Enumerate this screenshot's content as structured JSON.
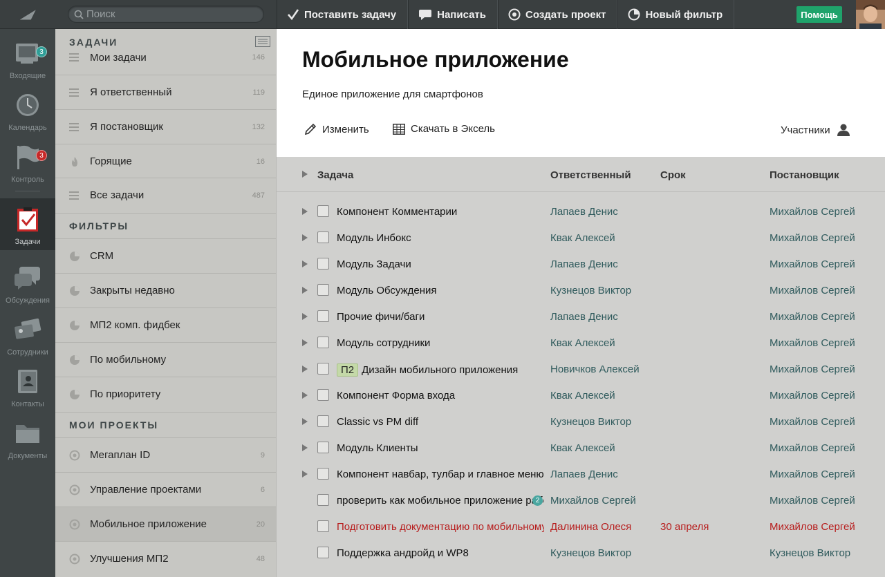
{
  "topbar": {
    "search_placeholder": "Поиск",
    "actions": [
      {
        "label": "Поставить задачу",
        "icon": "check-icon"
      },
      {
        "label": "Написать",
        "icon": "speech-bubble-icon"
      },
      {
        "label": "Создать проект",
        "icon": "target-icon"
      },
      {
        "label": "Новый фильтр",
        "icon": "pie-icon"
      }
    ],
    "help_label": "Помощь"
  },
  "leftnav": [
    {
      "label": "Входящие",
      "icon": "inbox-icon",
      "badge": "3"
    },
    {
      "label": "Календарь",
      "icon": "clock-icon"
    },
    {
      "label": "Контроль",
      "icon": "flag-icon",
      "badge": "3"
    },
    {
      "label": "Задачи",
      "icon": "clipboard-check-icon",
      "active": true
    },
    {
      "label": "Обсуждения",
      "icon": "chat-icon"
    },
    {
      "label": "Сотрудники",
      "icon": "id-cards-icon"
    },
    {
      "label": "Контакты",
      "icon": "address-book-icon"
    },
    {
      "label": "Документы",
      "icon": "folder-icon"
    }
  ],
  "sidebar": {
    "tasks_heading": "ЗАДАЧИ",
    "tasks": [
      {
        "label": "Мои задачи",
        "count": "146"
      },
      {
        "label": "Я ответственный",
        "count": "119"
      },
      {
        "label": "Я постановщик",
        "count": "132"
      },
      {
        "label": "Горящие",
        "count": "16"
      },
      {
        "label": "Все задачи",
        "count": "487"
      }
    ],
    "filters_heading": "ФИЛЬТРЫ",
    "filters": [
      {
        "label": "CRM"
      },
      {
        "label": "Закрыты недавно"
      },
      {
        "label": "МП2 комп. фидбек"
      },
      {
        "label": "По мобильному"
      },
      {
        "label": "По приоритету"
      }
    ],
    "projects_heading": "МОИ ПРОЕКТЫ",
    "projects": [
      {
        "label": "Мегаплан ID",
        "count": "9"
      },
      {
        "label": "Управление проектами",
        "count": "6"
      },
      {
        "label": "Мобильное приложение",
        "count": "20"
      },
      {
        "label": "Улучшения МП2",
        "count": "48"
      }
    ]
  },
  "project": {
    "title": "Мобильное приложение",
    "subtitle": "Единое приложение для смартфонов",
    "edit_label": "Изменить",
    "excel_label": "Скачать в Эксель",
    "members_label": "Участники"
  },
  "table": {
    "headers": {
      "task": "Задача",
      "responsible": "Ответственный",
      "due": "Срок",
      "author": "Постановщик"
    },
    "rows": [
      {
        "tag": "",
        "name": "Компонент Комментарии",
        "responsible": "Лапаев Денис",
        "due": "",
        "author": "Михайлов Сергей",
        "expandable": true
      },
      {
        "tag": "",
        "name": "Модуль Инбокс",
        "responsible": "Квак Алексей",
        "due": "",
        "author": "Михайлов Сергей",
        "expandable": true
      },
      {
        "tag": "",
        "name": "Модуль Задачи",
        "responsible": "Лапаев Денис",
        "due": "",
        "author": "Михайлов Сергей",
        "expandable": true
      },
      {
        "tag": "",
        "name": "Модуль Обсуждения",
        "responsible": "Кузнецов Виктор",
        "due": "",
        "author": "Михайлов Сергей",
        "expandable": true
      },
      {
        "tag": "",
        "name": "Прочие фичи/баги",
        "responsible": "Лапаев Денис",
        "due": "",
        "author": "Михайлов Сергей",
        "expandable": true
      },
      {
        "tag": "",
        "name": "Модуль сотрудники",
        "responsible": "Квак Алексей",
        "due": "",
        "author": "Михайлов Сергей",
        "expandable": true
      },
      {
        "tag": "П2",
        "name": "Дизайн мобильного приложения",
        "responsible": "Новичков Алексей",
        "due": "",
        "author": "Михайлов Сергей",
        "expandable": true
      },
      {
        "tag": "",
        "name": "Компонент Форма входа",
        "responsible": "Квак Алексей",
        "due": "",
        "author": "Михайлов Сергей",
        "expandable": true
      },
      {
        "tag": "",
        "name": "Classic vs PM diff",
        "responsible": "Кузнецов Виктор",
        "due": "",
        "author": "Михайлов Сергей",
        "expandable": true
      },
      {
        "tag": "",
        "name": "Модуль Клиенты",
        "responsible": "Квак Алексей",
        "due": "",
        "author": "Михайлов Сергей",
        "expandable": true
      },
      {
        "tag": "",
        "name": "Компонент навбар, тулбар и главное меню",
        "responsible": "Лапаев Денис",
        "due": "",
        "author": "Михайлов Сергей",
        "expandable": true
      },
      {
        "tag": "",
        "name": "проверить как мобильное приложение работает",
        "responsible": "Михайлов Сергей",
        "due": "",
        "author": "Михайлов Сергей",
        "expandable": false,
        "comments": "2"
      },
      {
        "tag": "",
        "name": "Подготовить документацию по мобильному",
        "responsible": "Далинина Олеся",
        "due": "30 апреля",
        "author": "Михайлов Сергей",
        "expandable": false,
        "overdue": true
      },
      {
        "tag": "",
        "name": "Поддержка андройд и WP8",
        "responsible": "Кузнецов Виктор",
        "due": "",
        "author": "Кузнецов Виктор",
        "expandable": false
      }
    ]
  },
  "colors": {
    "accent_green": "#1fa36b",
    "overdue_red": "#b71c1c",
    "link_teal": "#2f5a5c",
    "badge_teal": "#4aa6a0",
    "badge_red": "#c62828"
  }
}
